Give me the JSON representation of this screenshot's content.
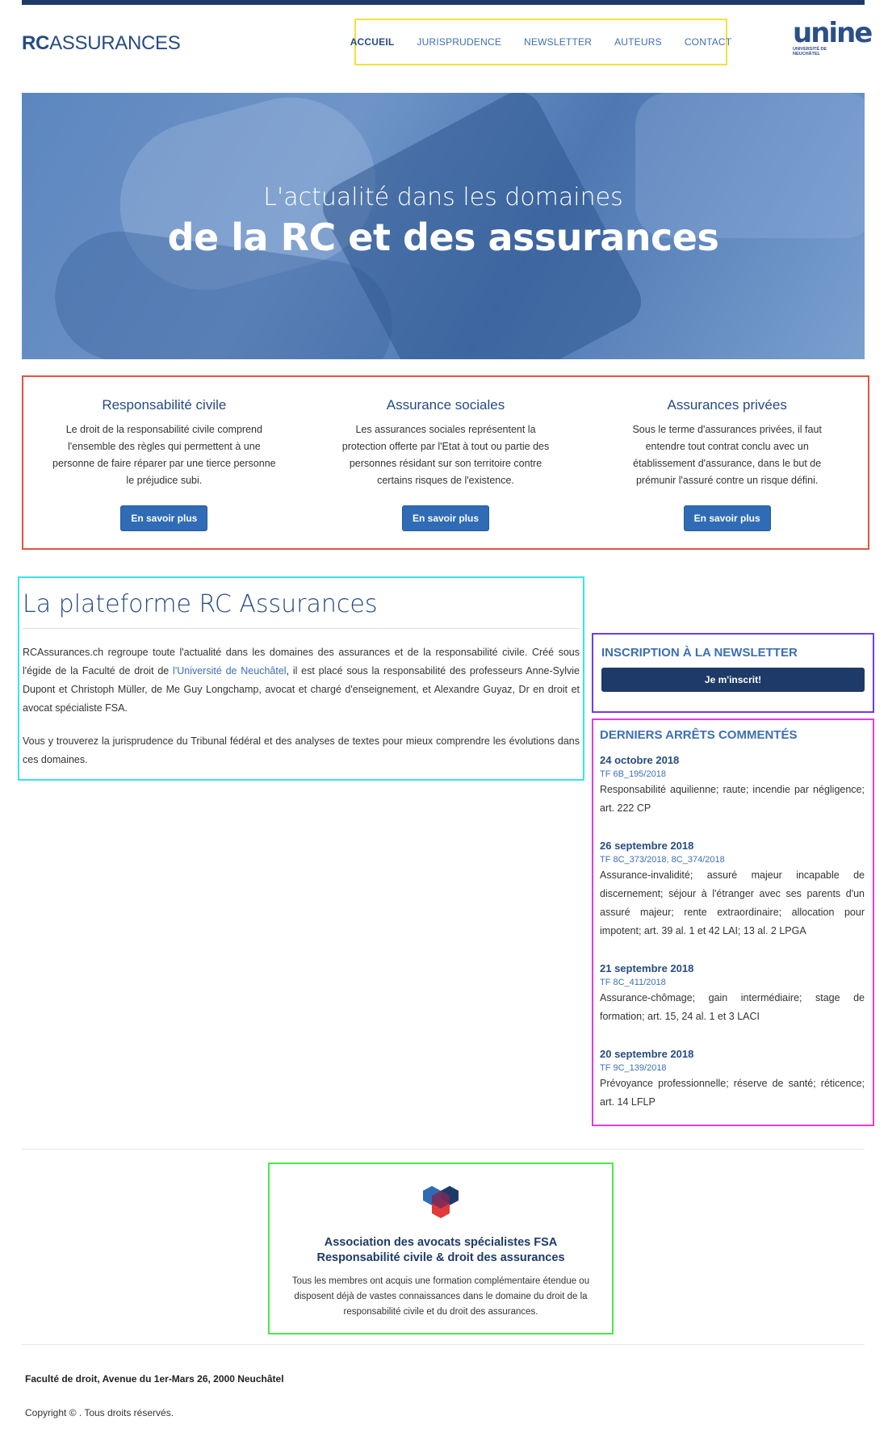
{
  "header": {
    "logo_bold": "RC",
    "logo_rest": "ASSURANCES",
    "nav": [
      "ACCUEIL",
      "JURISPRUDENCE",
      "NEWSLETTER",
      "AUTEURS",
      "CONTACT"
    ],
    "university_word": "unine",
    "university_sub_line1": "UNIVERSITÉ DE",
    "university_sub_line2": "NEUCHÂTEL"
  },
  "hero": {
    "subtitle": "L'actualité dans les domaines",
    "title": "de la RC et des assurances"
  },
  "features": [
    {
      "title": "Responsabilité civile",
      "text": "Le droit de la responsabilité civile comprend l'ensemble des règles qui permettent à une personne de faire réparer par une tierce personne le préjudice subi.",
      "button": "En savoir plus"
    },
    {
      "title": "Assurance sociales",
      "text": "Les assurances sociales représentent la protection offerte par l'Etat à tout ou partie des personnes résidant sur son territoire contre certains risques de l'existence.",
      "button": "En savoir plus"
    },
    {
      "title": "Assurances privées",
      "text": "Sous le terme d'assurances privées, il faut entendre tout contrat conclu avec un établissement d'assurance, dans le but de prémunir l'assuré contre un risque défini.",
      "button": "En savoir plus"
    }
  ],
  "about": {
    "title": "La plateforme RC Assurances",
    "p1_before": "RCAssurances.ch regroupe toute l'actualité dans les domaines des assurances et de la responsabilité civile. Créé sous l'égide de la Faculté de droit de ",
    "p1_link": "l'Université de Neuchâtel",
    "p1_after": ", il est placé sous la responsabilité des professeurs Anne-Sylvie Dupont et Christoph Müller, de Me Guy Longchamp, avocat et chargé d'enseignement, et Alexandre Guyaz, Dr en droit et avocat spécialiste FSA.",
    "p2": "Vous y trouverez la jurisprudence du Tribunal fédéral et des analyses de textes pour mieux comprendre les évolutions dans ces domaines."
  },
  "newsletter": {
    "title": "INSCRIPTION À LA NEWSLETTER",
    "button": "Je m'inscrit!"
  },
  "arrets": {
    "title": "DERNIERS ARRÊTS COMMENTÉS",
    "items": [
      {
        "date": "24 octobre 2018",
        "ref": "TF 6B_195/2018",
        "desc": "Responsabilité aquilienne; raute; incendie par négligence; art. 222 CP"
      },
      {
        "date": "26 septembre 2018",
        "ref": "TF 8C_373/2018, 8C_374/2018",
        "desc": "Assurance-invalidité; assuré majeur incapable de discernement; séjour à l'étranger avec ses parents d'un assuré majeur; rente extraordinaire; allocation pour impotent; art. 39 al. 1 et 42 LAI; 13 al. 2 LPGA"
      },
      {
        "date": "21 septembre 2018",
        "ref": "TF 8C_411/2018",
        "desc": "Assurance-chômage; gain intermédiaire; stage de formation; art. 15, 24 al. 1 et 3 LACI"
      },
      {
        "date": "20 septembre 2018",
        "ref": "TF 9C_139/2018",
        "desc": "Prévoyance professionnelle; réserve de santé; réticence; art. 14 LFLP"
      }
    ]
  },
  "fsa": {
    "title_line1": "Association des avocats spécialistes FSA",
    "title_line2": "Responsabilité civile & droit des assurances",
    "text": "Tous les membres ont acquis une formation complémentaire étendue ou disposent déjà de vastes connaissances dans le domaine du droit de la responsabilité civile et du droit des assurances."
  },
  "footer": {
    "address": "Faculté de droit, Avenue du 1er-Mars 26, 2000 Neuchâtel",
    "copyright": "Copyright © . Tous droits réservés."
  },
  "colors": {
    "brand_dark": "#1e3a68",
    "brand": "#264b82",
    "link": "#3d6fb4",
    "button": "#2f6cb5"
  }
}
